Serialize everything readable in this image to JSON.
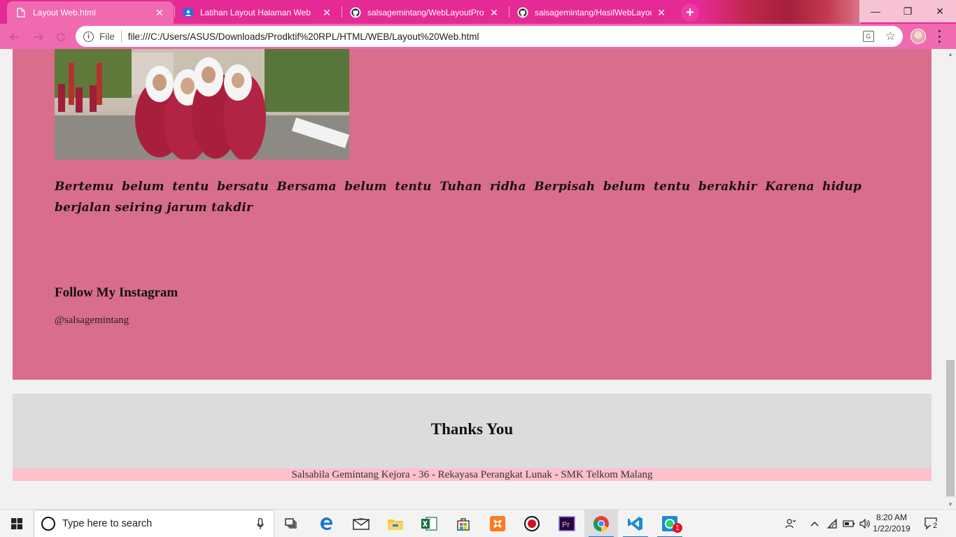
{
  "browser": {
    "tabs": [
      {
        "title": "Layout Web.html",
        "icon": "file-icon",
        "active": true
      },
      {
        "title": "Latihan Layout Halaman Web",
        "icon": "classroom-icon",
        "active": false
      },
      {
        "title": "salsagemintang/WebLayoutProfil",
        "icon": "github-icon",
        "active": false
      },
      {
        "title": "salsagemintang/HasilWebLayout",
        "icon": "github-icon",
        "active": false
      }
    ],
    "new_tab_label": "+",
    "window_controls": {
      "minimize": "—",
      "restore": "❐",
      "close": "✕"
    },
    "address_bar": {
      "scheme_label": "File",
      "url": "file:///C:/Users/ASUS/Downloads/Prodktif%20RPL/HTML/WEB/Layout%20Web.html"
    },
    "colors": {
      "tab_strip": "#e52a96",
      "toolbar": "#f06ab0"
    }
  },
  "page": {
    "quote": "Bertemu belum tentu bersatu Bersama belum tentu Tuhan ridha Berpisah belum tentu berakhir Karena hidup berjalan seiring jarum takdir",
    "follow_title": "Follow My Instagram",
    "instagram_handle": "@salsagemintang",
    "footer_title": "Thanks You",
    "credit": "Salsabila Gemintang Kejora - 36 - Rekayasa Perangkat Lunak - SMK Telkom Malang",
    "colors": {
      "main_section": "#d96d8c",
      "footer_box": "#dcdcdc",
      "credit_bar": "#ffc0cb"
    }
  },
  "taskbar": {
    "search_placeholder": "Type here to search",
    "apps": [
      "task-view-icon",
      "edge-icon",
      "mail-icon",
      "file-explorer-icon",
      "excel-icon",
      "store-icon",
      "xampp-icon",
      "recorder-icon",
      "premiere-icon",
      "chrome-icon",
      "vscode-icon",
      "whatsapp-icon"
    ],
    "whatsapp_badge": "1",
    "clock_time": "8:20 AM",
    "clock_date": "1/22/2019",
    "notification_count": "2"
  }
}
